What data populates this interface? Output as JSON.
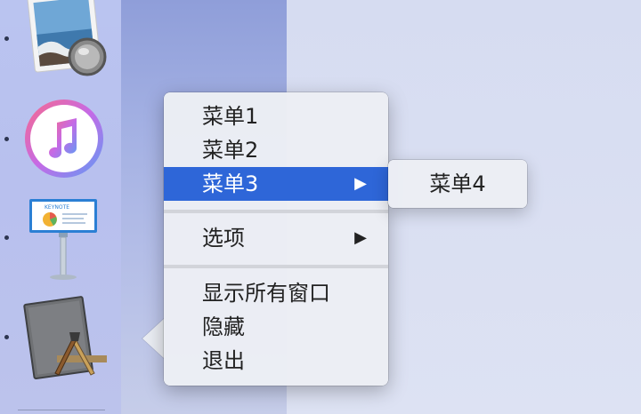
{
  "dock": {
    "apps": [
      {
        "name": "preview",
        "running": true
      },
      {
        "name": "itunes",
        "running": true
      },
      {
        "name": "keynote",
        "running": true
      },
      {
        "name": "xcode",
        "running": true
      }
    ],
    "keynote_label": "KEYNOTE"
  },
  "context_menu": {
    "items": [
      {
        "label": "菜单1",
        "has_submenu": false,
        "selected": false
      },
      {
        "label": "菜单2",
        "has_submenu": false,
        "selected": false
      },
      {
        "label": "菜单3",
        "has_submenu": true,
        "selected": true
      },
      {
        "label": "选项",
        "has_submenu": true,
        "selected": false
      },
      {
        "label": "显示所有窗口",
        "has_submenu": false,
        "selected": false
      },
      {
        "label": "隐藏",
        "has_submenu": false,
        "selected": false
      },
      {
        "label": "退出",
        "has_submenu": false,
        "selected": false
      }
    ],
    "arrow_glyph": "▶"
  },
  "submenu": {
    "items": [
      {
        "label": "菜单4"
      }
    ]
  },
  "colors": {
    "selection": "#2e66d8",
    "menu_bg": "#eceef4",
    "dock_bg": "#bac4f0"
  }
}
